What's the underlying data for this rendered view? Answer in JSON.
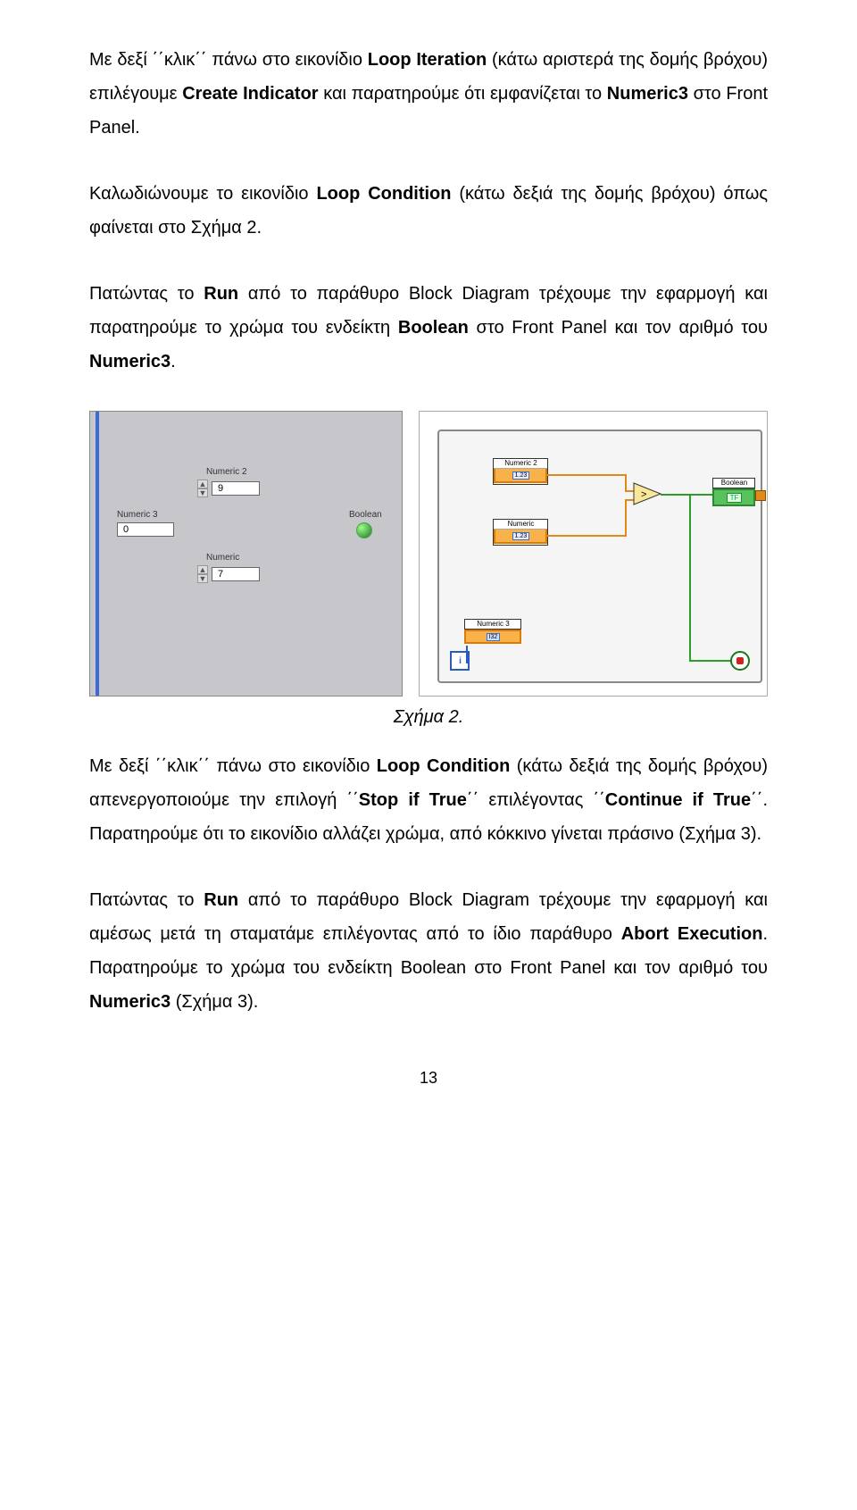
{
  "p1": {
    "a": "Με δεξί ΄΄κλικ΄΄ πάνω στο εικονίδιο ",
    "b": "Loop Iteration",
    "c": " (κάτω αριστερά της δομής βρόχου) επιλέγουμε ",
    "d": "Create Indicator",
    "e": " και παρατηρούμε ότι εμφανίζεται το ",
    "f": "Numeric3",
    "g": " στο Front Panel."
  },
  "p2": {
    "a": "Καλωδιώνουμε το εικονίδιο ",
    "b": "Loop Condition",
    "c": " (κάτω δεξιά της δομής βρόχου) όπως φαίνεται στο Σχήμα 2."
  },
  "p3": {
    "a": "Πατώντας το ",
    "b": "Run",
    "c": " από το παράθυρο Block Diagram τρέχουμε την εφαρμογή και παρατηρούμε το χρώμα του ενδείκτη ",
    "d": "Boolean",
    "e": " στο Front Panel και τον αριθμό του ",
    "f": "Numeric3",
    "g": "."
  },
  "figL": {
    "numeric2_lbl": "Numeric 2",
    "numeric2_val": "9",
    "numeric_lbl": "Numeric",
    "numeric_val": "7",
    "numeric3_lbl": "Numeric 3",
    "numeric3_val": "0",
    "boolean_lbl": "Boolean"
  },
  "figR": {
    "numeric2": "Numeric 2",
    "numeric": "Numeric",
    "numeric3": "Numeric 3",
    "boolean": "Boolean",
    "n2_val": "1.23",
    "n_val": "1.23",
    "n3_val": "I32",
    "bool_txt": "TF",
    "iter": "i"
  },
  "cap": "Σχήμα 2.",
  "p4": {
    "a": "Με δεξί ΄΄κλικ΄΄ πάνω στο εικονίδιο ",
    "b": "Loop Condition",
    "c": " (κάτω δεξιά της δομής βρόχου) απενεργοποιούμε την επιλογή ΄΄",
    "d": "Stop if True",
    "e": "΄΄ επιλέγοντας ΄΄",
    "f": "Continue if True",
    "g": "΄΄. Παρατηρούμε ότι το εικονίδιο αλλάζει χρώμα, από κόκκινο γίνεται πράσινο (Σχήμα 3)."
  },
  "p5": {
    "a": "Πατώντας το ",
    "b": "Run",
    "c": " από το παράθυρο Block Diagram τρέχουμε την εφαρμογή και αμέσως μετά τη σταματάμε επιλέγοντας από το ίδιο παράθυρο ",
    "d": "Abort Execution",
    "e": ". Παρατηρούμε το χρώμα του ενδείκτη Boolean στο Front Panel και τον αριθμό του ",
    "f": "Numeric3",
    "g": " (Σχήμα 3)."
  },
  "pagenum": "13"
}
